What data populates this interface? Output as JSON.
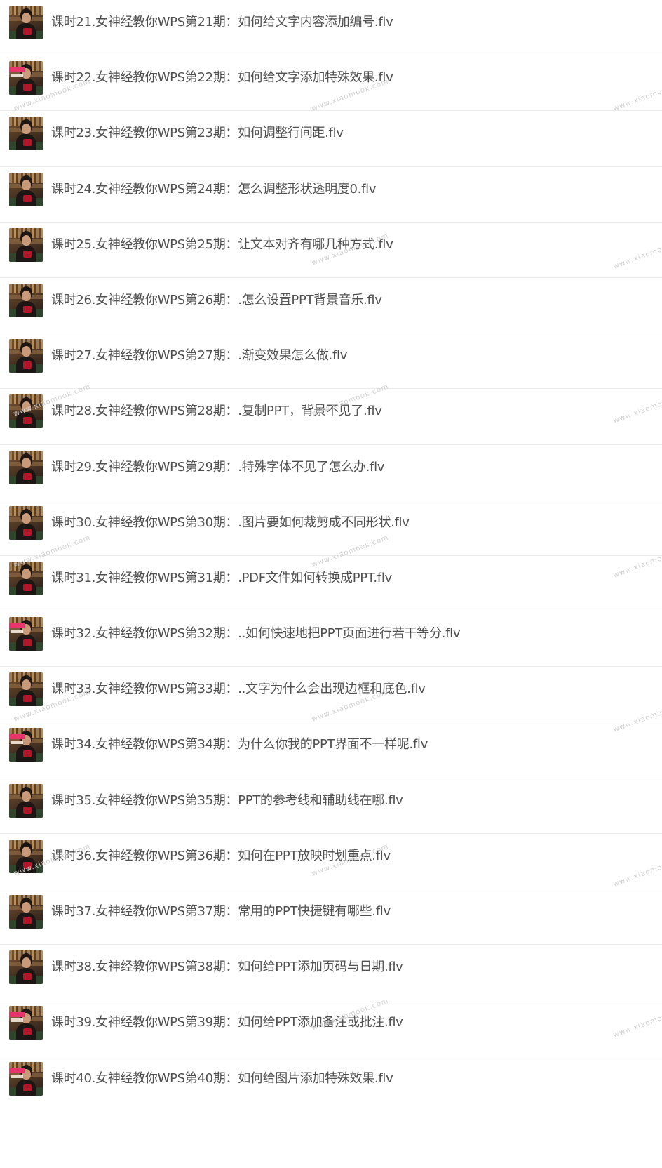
{
  "files": [
    {
      "title": "课时21.女神经教你WPS第21期：如何给文字内容添加编号.flv",
      "thumb_variant": "plain"
    },
    {
      "title": "课时22.女神经教你WPS第22期：如何给文字添加特殊效果.flv",
      "thumb_variant": "tagged"
    },
    {
      "title": "课时23.女神经教你WPS第23期：如何调整行间距.flv",
      "thumb_variant": "plain"
    },
    {
      "title": "课时24.女神经教你WPS第24期：怎么调整形状透明度0.flv",
      "thumb_variant": "plain"
    },
    {
      "title": "课时25.女神经教你WPS第25期：让文本对齐有哪几种方式.flv",
      "thumb_variant": "plain"
    },
    {
      "title": "课时26.女神经教你WPS第26期：.怎么设置PPT背景音乐.flv",
      "thumb_variant": "plain"
    },
    {
      "title": "课时27.女神经教你WPS第27期：.渐变效果怎么做.flv",
      "thumb_variant": "plain"
    },
    {
      "title": "课时28.女神经教你WPS第28期：.复制PPT，背景不见了.flv",
      "thumb_variant": "plain"
    },
    {
      "title": "课时29.女神经教你WPS第29期：.特殊字体不见了怎么办.flv",
      "thumb_variant": "plain"
    },
    {
      "title": "课时30.女神经教你WPS第30期：.图片要如何裁剪成不同形状.flv",
      "thumb_variant": "plain"
    },
    {
      "title": "课时31.女神经教你WPS第31期：.PDF文件如何转换成PPT.flv",
      "thumb_variant": "plain"
    },
    {
      "title": "课时32.女神经教你WPS第32期：..如何快速地把PPT页面进行若干等分.flv",
      "thumb_variant": "tagged"
    },
    {
      "title": "课时33.女神经教你WPS第33期：..文字为什么会出现边框和底色.flv",
      "thumb_variant": "plain"
    },
    {
      "title": "课时34.女神经教你WPS第34期：为什么你我的PPT界面不一样呢.flv",
      "thumb_variant": "tagged"
    },
    {
      "title": "课时35.女神经教你WPS第35期：PPT的参考线和辅助线在哪.flv",
      "thumb_variant": "plain"
    },
    {
      "title": "课时36.女神经教你WPS第36期：如何在PPT放映时划重点.flv",
      "thumb_variant": "plain"
    },
    {
      "title": "课时37.女神经教你WPS第37期：常用的PPT快捷键有哪些.flv",
      "thumb_variant": "plain"
    },
    {
      "title": "课时38.女神经教你WPS第38期：如何给PPT添加页码与日期.flv",
      "thumb_variant": "plain"
    },
    {
      "title": "课时39.女神经教你WPS第39期：如何给PPT添加备注或批注.flv",
      "thumb_variant": "tagged"
    },
    {
      "title": "课时40.女神经教你WPS第40期：如何给图片添加特殊效果.flv",
      "thumb_variant": "tagged"
    }
  ],
  "watermark_text": "www.xiaomook.com",
  "colors": {
    "title_text": "#505050",
    "divider": "#ececec",
    "background": "#ffffff",
    "watermark": "#d0d0d0"
  }
}
